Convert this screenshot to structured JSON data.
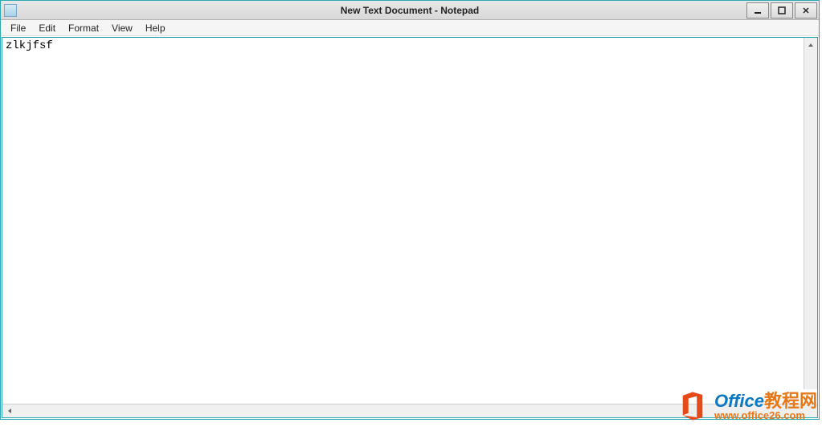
{
  "titlebar": {
    "title": "New Text Document - Notepad",
    "minimize": "—",
    "maximize": "❐",
    "close": "✕"
  },
  "menubar": {
    "items": [
      "File",
      "Edit",
      "Format",
      "View",
      "Help"
    ]
  },
  "editor": {
    "content": "zlkjfsf"
  },
  "watermark": {
    "title_en": "Office",
    "title_cn": "教程网",
    "url": "www.office26.com"
  }
}
